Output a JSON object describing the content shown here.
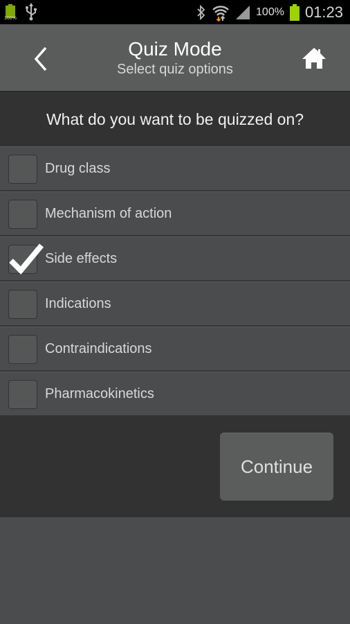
{
  "status_bar": {
    "left_battery_percent": "100%",
    "battery_percent": "100%",
    "time": "01:23",
    "icons": [
      "battery-icon",
      "usb-icon",
      "bluetooth-icon",
      "wifi-icon",
      "signal-icon",
      "battery-icon"
    ]
  },
  "header": {
    "title": "Quiz Mode",
    "subtitle": "Select quiz options",
    "back_icon": "chevron-left-icon",
    "home_icon": "home-icon"
  },
  "question": {
    "text": "What do you want to be quizzed on?"
  },
  "options": [
    {
      "label": "Drug class",
      "checked": false
    },
    {
      "label": "Mechanism of action",
      "checked": false
    },
    {
      "label": "Side effects",
      "checked": true
    },
    {
      "label": "Indications",
      "checked": false
    },
    {
      "label": "Contraindications",
      "checked": false
    },
    {
      "label": "Pharmacokinetics",
      "checked": false
    }
  ],
  "footer": {
    "continue_label": "Continue"
  },
  "colors": {
    "status_bar_bg": "#000000",
    "app_bar_bg": "#5a5b5b",
    "question_bg": "#323232",
    "row_bg": "#4b4c4d",
    "battery_green": "#9bd400"
  }
}
